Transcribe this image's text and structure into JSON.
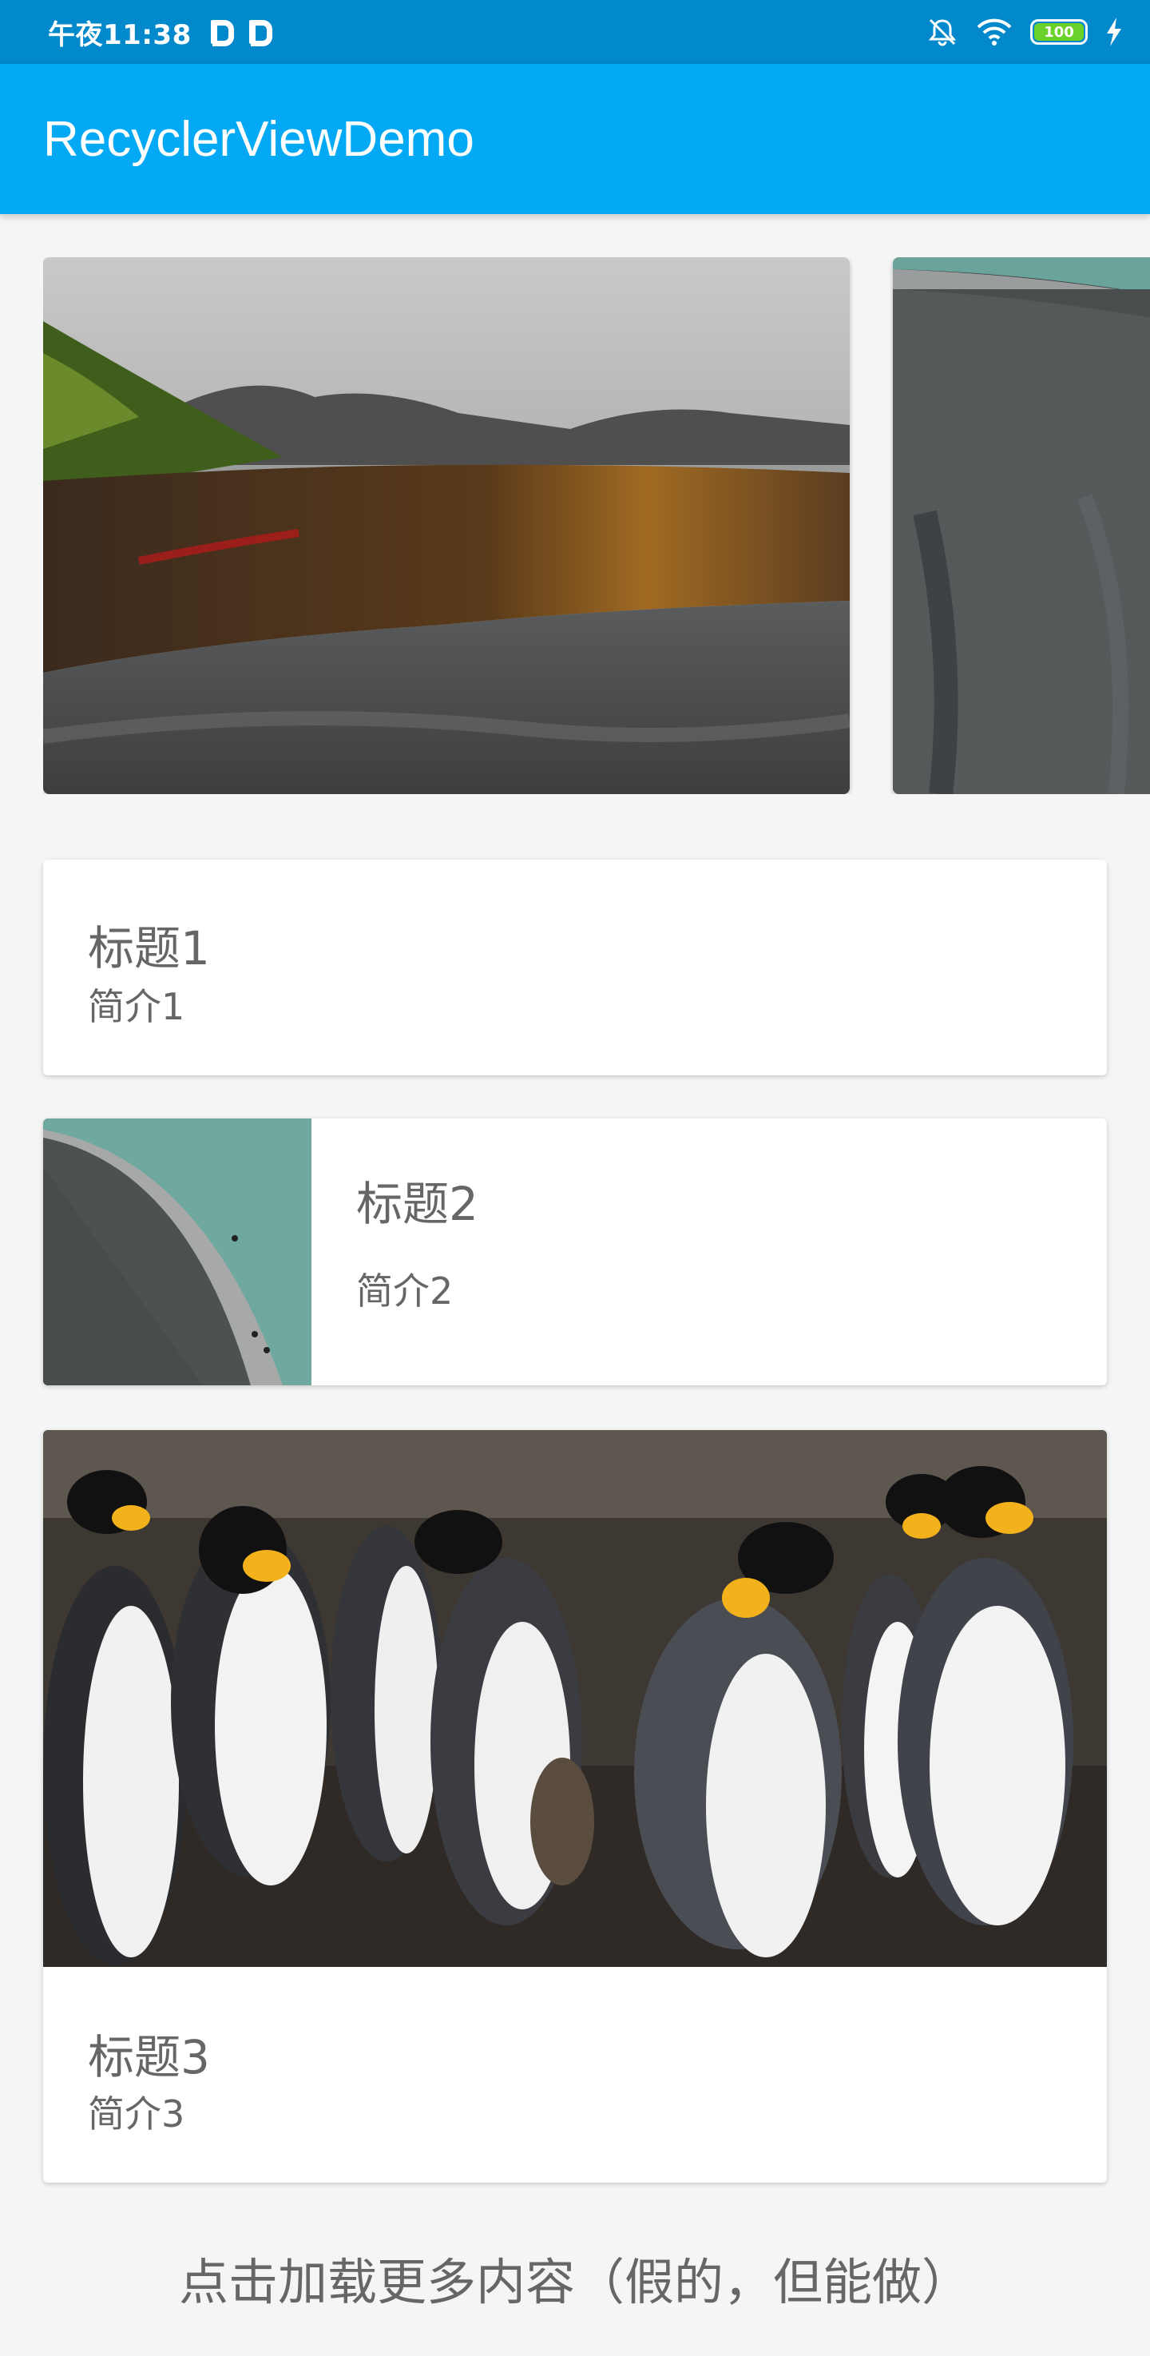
{
  "status_bar": {
    "time": "午夜11:38",
    "battery_level": "100",
    "icons": [
      "parking-icon",
      "parking-icon",
      "mute-bell-icon",
      "wifi-icon",
      "battery-icon",
      "charging-icon"
    ]
  },
  "app_bar": {
    "title": "RecyclerViewDemo"
  },
  "horizontal_list": {
    "images": [
      "landscape-lake-image",
      "dam-image"
    ]
  },
  "cards": [
    {
      "title": "标题1",
      "subtitle": "简介1"
    },
    {
      "title": "标题2",
      "subtitle": "简介2",
      "image": "dam-thumbnail"
    },
    {
      "title": "标题3",
      "subtitle": "简介3",
      "image": "penguins-image"
    }
  ],
  "footer": {
    "load_more": "点击加载更多内容（假的，但能做）"
  },
  "colors": {
    "status_bar": "#0189cc",
    "app_bar": "#03a9f4",
    "background": "#f5f5f5",
    "text": "#666666"
  }
}
